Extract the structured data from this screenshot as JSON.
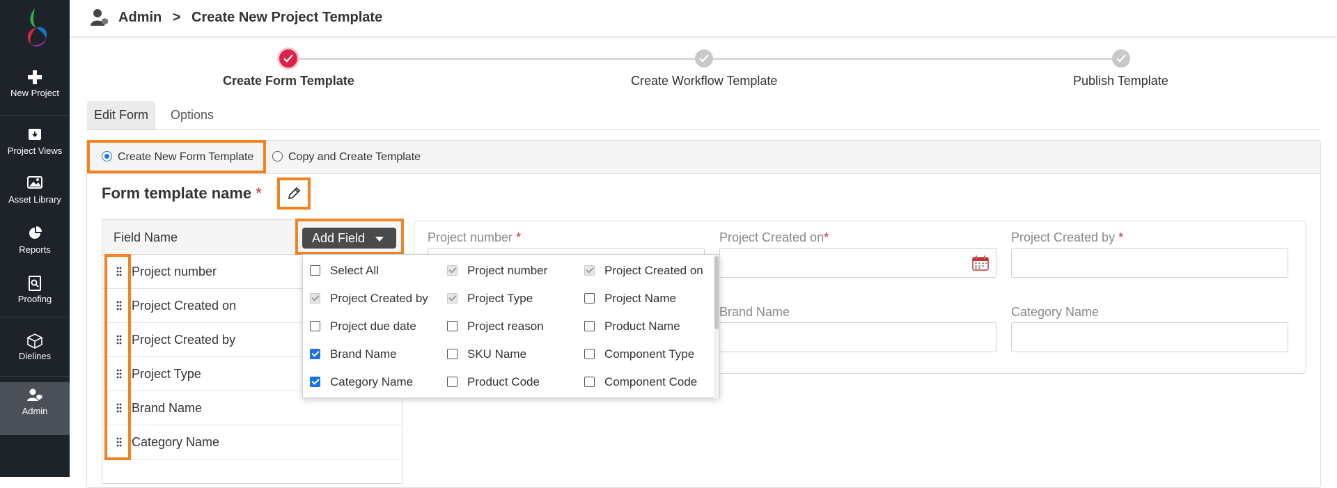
{
  "sidebar": {
    "items": [
      {
        "label": "New Project",
        "icon": "plus-icon"
      },
      {
        "label": "Project Views",
        "icon": "archive-icon"
      },
      {
        "label": "Asset Library",
        "icon": "image-icon"
      },
      {
        "label": "Reports",
        "icon": "pie-chart-icon"
      },
      {
        "label": "Proofing",
        "icon": "proof-search-icon"
      },
      {
        "label": "Dielines",
        "icon": "cube-icon"
      },
      {
        "label": "Admin",
        "icon": "admin-user-icon"
      }
    ]
  },
  "header": {
    "crumb_root": "Admin",
    "crumb_sep": ">",
    "crumb_current": "Create New Project Template"
  },
  "stepper": {
    "steps": [
      {
        "label": "Create Form Template",
        "state": "active"
      },
      {
        "label": "Create Workflow Template",
        "state": "pending"
      },
      {
        "label": "Publish Template",
        "state": "pending"
      }
    ]
  },
  "tabs": [
    {
      "label": "Edit Form",
      "active": true
    },
    {
      "label": "Options",
      "active": false
    }
  ],
  "mode": {
    "option1": "Create New Form Template",
    "option2": "Copy and Create Template",
    "selected": "Create New Form Template"
  },
  "form": {
    "title": "Form template name",
    "required_mark": "*"
  },
  "field_list": {
    "header": "Field Name",
    "add_button": "Add Field",
    "rows": [
      "Project number",
      "Project Created on",
      "Project Created by",
      "Project Type",
      "Brand Name",
      "Category Name"
    ]
  },
  "dropdown": {
    "items": [
      {
        "label": "Select All",
        "state": "unchecked"
      },
      {
        "label": "Project number",
        "state": "disabled"
      },
      {
        "label": "Project Created on",
        "state": "disabled"
      },
      {
        "label": "Project Created by",
        "state": "disabled"
      },
      {
        "label": "Project Type",
        "state": "disabled"
      },
      {
        "label": "Project Name",
        "state": "unchecked"
      },
      {
        "label": "Project due date",
        "state": "unchecked"
      },
      {
        "label": "Project reason",
        "state": "unchecked"
      },
      {
        "label": "Product Name",
        "state": "unchecked"
      },
      {
        "label": "Brand Name",
        "state": "checked"
      },
      {
        "label": "SKU Name",
        "state": "unchecked"
      },
      {
        "label": "Component Type",
        "state": "unchecked"
      },
      {
        "label": "Category Name",
        "state": "checked"
      },
      {
        "label": "Product Code",
        "state": "unchecked"
      },
      {
        "label": "Component Code",
        "state": "unchecked"
      }
    ]
  },
  "preview": {
    "fields": [
      {
        "label": "Project number",
        "required": "*"
      },
      {
        "label": "Project Created on",
        "required": "*"
      },
      {
        "label": "Project Created by",
        "required": "*"
      },
      {
        "label": "Brand Name",
        "required": ""
      },
      {
        "label": "Category Name",
        "required": ""
      }
    ]
  },
  "colors": {
    "sidebar_bg": "#1e2229",
    "highlight": "#f58220",
    "accent": "#d8244a",
    "check": "#1a73e8"
  }
}
